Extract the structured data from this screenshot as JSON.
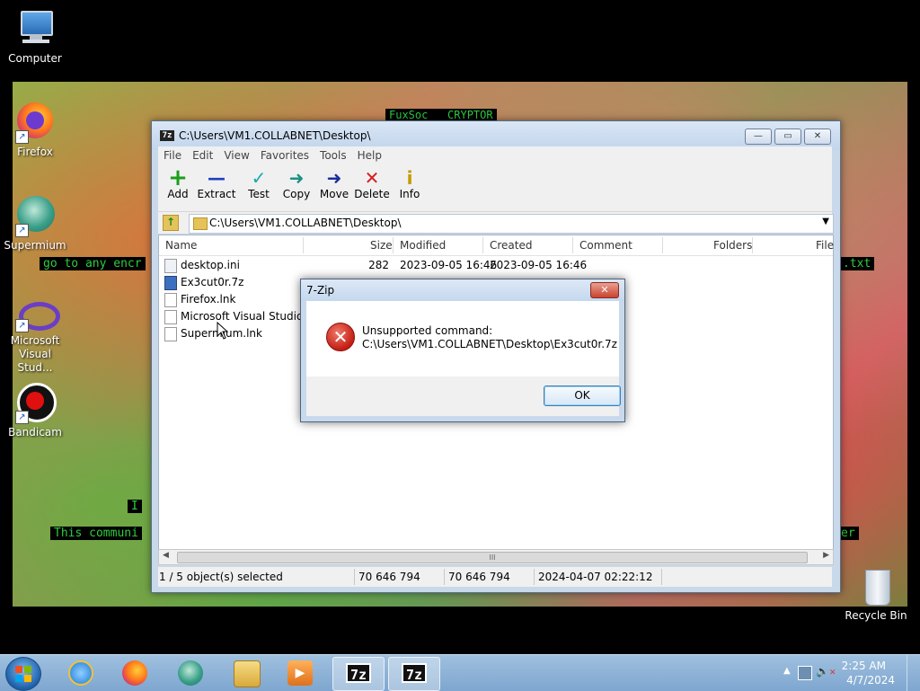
{
  "desktop": {
    "icons": [
      {
        "label": "Computer"
      },
      {
        "label": "Firefox"
      },
      {
        "label": "Supermium"
      },
      {
        "label": "Microsoft Visual Stud..."
      },
      {
        "label": "Bandicam"
      },
      {
        "label": "Recycle Bin"
      }
    ],
    "wallpaper_text": {
      "top": "FuxSoc   CRYPTOR",
      "line1": "go to any encr",
      "line1_right": ".txt",
      "line2": "This communi",
      "line2_right": "er",
      "fragment": "I"
    }
  },
  "window": {
    "title": "C:\\Users\\VM1.COLLABNET\\Desktop\\",
    "app_icon": "7z",
    "caption_buttons": {
      "minimize": "—",
      "maximize": "▭",
      "close": "✕"
    },
    "menu": [
      "File",
      "Edit",
      "View",
      "Favorites",
      "Tools",
      "Help"
    ],
    "toolbar": [
      {
        "label": "Add",
        "icon": "add-icon",
        "glyph": "+",
        "color": "#1a9e1a"
      },
      {
        "label": "Extract",
        "icon": "extract-icon",
        "glyph": "—",
        "color": "#1f3fbf"
      },
      {
        "label": "Test",
        "icon": "test-icon",
        "glyph": "✓",
        "color": "#16a8b0"
      },
      {
        "label": "Copy",
        "icon": "copy-icon",
        "glyph": "➜",
        "color": "#1c8f85"
      },
      {
        "label": "Move",
        "icon": "move-icon",
        "glyph": "➜",
        "color": "#1a2f9c"
      },
      {
        "label": "Delete",
        "icon": "delete-icon",
        "glyph": "✕",
        "color": "#d21d1d"
      },
      {
        "label": "Info",
        "icon": "info-icon",
        "glyph": "i",
        "color": "#c49a00"
      }
    ],
    "address": "C:\\Users\\VM1.COLLABNET\\Desktop\\",
    "columns": [
      "Name",
      "Size",
      "Modified",
      "Created",
      "Comment",
      "Folders",
      "File"
    ],
    "files": [
      {
        "name": "desktop.ini",
        "size": "282",
        "modified": "2023-09-05 16:46",
        "created": "2023-09-05 16:46"
      },
      {
        "name": "Ex3cut0r.7z",
        "size": "",
        "modified": "",
        "created": ""
      },
      {
        "name": "Firefox.lnk",
        "size": "",
        "modified": "",
        "created": ""
      },
      {
        "name": "Microsoft Visual Studio ...",
        "size": "",
        "modified": "",
        "created": ""
      },
      {
        "name": "Supermium.lnk",
        "size": "",
        "modified": "",
        "created": ""
      }
    ],
    "status": {
      "selection": "1 / 5 object(s) selected",
      "size": "70 646 794",
      "packed": "70 646 794",
      "date": "2024-04-07 02:22:12"
    },
    "scrollbar_grip": "III"
  },
  "dialog": {
    "title": "7-Zip",
    "close": "✕",
    "icon": "error-icon",
    "message_line1": "Unsupported command:",
    "message_line2": "C:\\Users\\VM1.COLLABNET\\Desktop\\Ex3cut0r.7z",
    "ok_label": "OK"
  },
  "taskbar": {
    "items": [
      {
        "name": "internet-explorer"
      },
      {
        "name": "firefox"
      },
      {
        "name": "supermium"
      },
      {
        "name": "file-explorer"
      },
      {
        "name": "media-player"
      },
      {
        "name": "7zip-window-1",
        "label": "7z"
      },
      {
        "name": "7zip-window-2",
        "label": "7z"
      }
    ],
    "clock_time": "2:25 AM",
    "clock_date": "4/7/2024"
  }
}
